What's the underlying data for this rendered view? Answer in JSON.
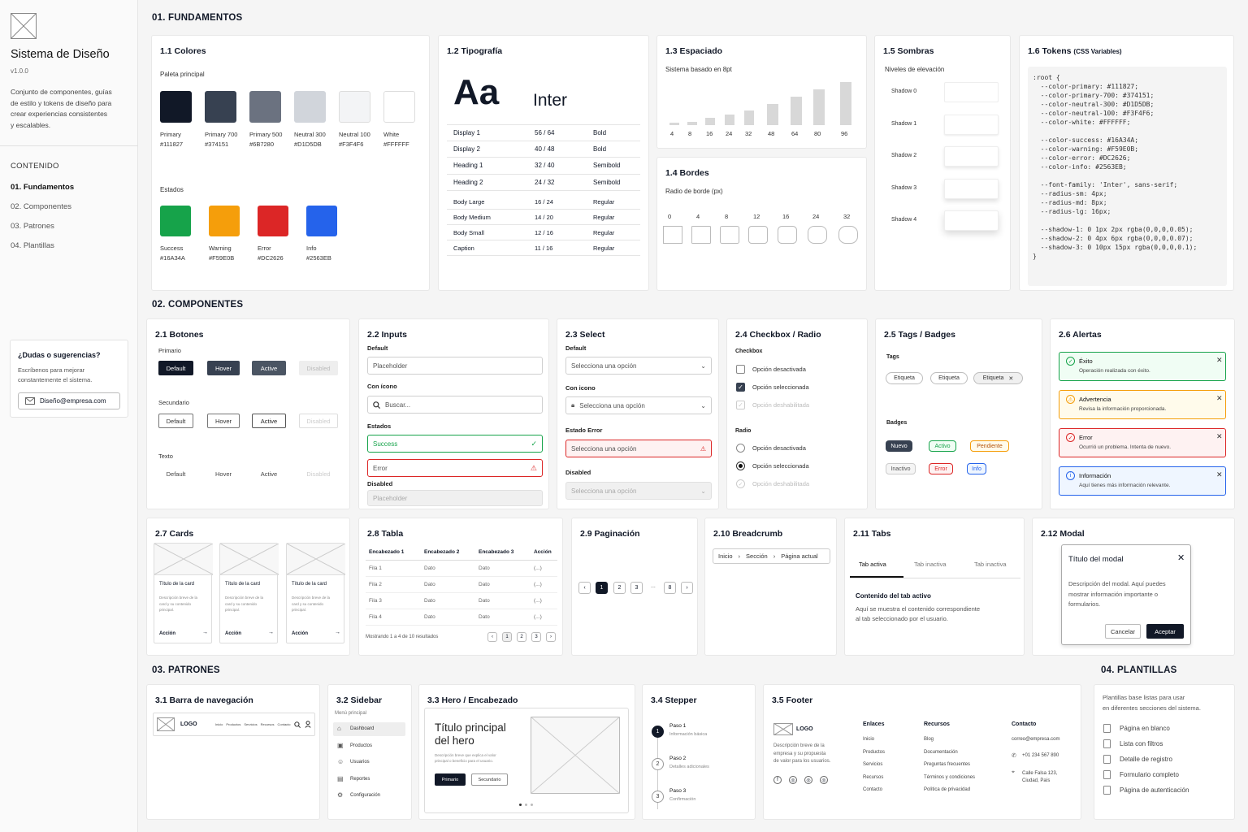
{
  "sidebar": {
    "title": "Sistema de Diseño",
    "version": "v1.0.0",
    "desc": [
      "Conjunto de componentes, guías",
      "de estilo y tokens de diseño para",
      "crear experiencias consistentes",
      "y escalables."
    ],
    "contents_label": "CONTENIDO",
    "nav": [
      "01. Fundamentos",
      "02. Componentes",
      "03. Patrones",
      "04. Plantillas"
    ],
    "help": {
      "title": "¿Dudas o sugerencias?",
      "text": [
        "Escríbenos para mejorar",
        "constantemente el sistema."
      ],
      "email": "Diseño@empresa.com"
    }
  },
  "sections": {
    "s1": "01. FUNDAMENTOS",
    "s2": "02. COMPONENTES",
    "s3": "03. PATRONES",
    "s4": "04. PLANTILLAS"
  },
  "colors": {
    "title": "1.1 Colores",
    "palette_label": "Paleta principal",
    "states_label": "Estados",
    "palette": [
      {
        "name": "Primary",
        "hex": "#111827"
      },
      {
        "name": "Primary 700",
        "hex": "#374151"
      },
      {
        "name": "Primary 500",
        "hex": "#6B7280"
      },
      {
        "name": "Neutral 300",
        "hex": "#D1D5DB"
      },
      {
        "name": "Neutral 100",
        "hex": "#F3F4F6"
      },
      {
        "name": "White",
        "hex": "#FFFFFF"
      }
    ],
    "states": [
      {
        "name": "Success",
        "hex": "#16A34A"
      },
      {
        "name": "Warning",
        "hex": "#F59E0B"
      },
      {
        "name": "Error",
        "hex": "#DC2626"
      },
      {
        "name": "Info",
        "hex": "#2563EB"
      }
    ]
  },
  "typo": {
    "title": "1.2 Tipografía",
    "sample": "Aa",
    "font": "Inter",
    "rows": [
      {
        "n": "Display 1",
        "s": "56 / 64",
        "w": "Bold"
      },
      {
        "n": "Display 2",
        "s": "40 / 48",
        "w": "Bold"
      },
      {
        "n": "Heading 1",
        "s": "32 / 40",
        "w": "Semibold"
      },
      {
        "n": "Heading 2",
        "s": "24 / 32",
        "w": "Semibold"
      },
      {
        "n": "Body Large",
        "s": "16 / 24",
        "w": "Regular"
      },
      {
        "n": "Body Medium",
        "s": "14 / 20",
        "w": "Regular"
      },
      {
        "n": "Body Small",
        "s": "12 / 16",
        "w": "Regular"
      },
      {
        "n": "Caption",
        "s": "11 / 16",
        "w": "Regular"
      }
    ]
  },
  "spacing": {
    "title": "1.3 Espaciado",
    "subtitle": "Sistema basado en 8pt",
    "values": [
      "4",
      "8",
      "16",
      "24",
      "32",
      "48",
      "64",
      "80",
      "96"
    ]
  },
  "borders": {
    "title": "1.4 Bordes",
    "subtitle": "Radio de borde (px)",
    "values": [
      "0",
      "4",
      "8",
      "12",
      "16",
      "24",
      "32"
    ]
  },
  "shadows": {
    "title": "1.5 Sombras",
    "subtitle": "Niveles de elevación",
    "items": [
      "Shadow 0",
      "Shadow 1",
      "Shadow 2",
      "Shadow 3",
      "Shadow 4"
    ]
  },
  "tokens": {
    "title": "1.6 Tokens",
    "title_suffix": "(CSS Variables)",
    "code": ":root {\n  --color-primary: #111827;\n  --color-primary-700: #374151;\n  --color-neutral-300: #D1D5DB;\n  --color-neutral-100: #F3F4F6;\n  --color-white: #FFFFFF;\n\n  --color-success: #16A34A;\n  --color-warning: #F59E0B;\n  --color-error: #DC2626;\n  --color-info: #2563EB;\n\n  --font-family: 'Inter', sans-serif;\n  --radius-sm: 4px;\n  --radius-md: 8px;\n  --radius-lg: 16px;\n\n  --shadow-1: 0 1px 2px rgba(0,0,0,0.05);\n  --shadow-2: 0 4px 6px rgba(0,0,0,0.07);\n  --shadow-3: 0 10px 15px rgba(0,0,0,0.1);\n}"
  },
  "buttons": {
    "title": "2.1 Botones",
    "primary": "Primario",
    "secondary": "Secundario",
    "text": "Texto",
    "states": [
      "Default",
      "Hover",
      "Active",
      "Disabled"
    ]
  },
  "inputs": {
    "title": "2.2 Inputs",
    "default": "Default",
    "placeholder": "Placeholder",
    "with_icon": "Con ícono",
    "search": "Buscar...",
    "states": "Estados",
    "success": "Success",
    "error": "Error",
    "disabled": "Disabled"
  },
  "select": {
    "title": "2.3 Select",
    "default": "Default",
    "option": "Selecciona una opción",
    "with_icon": "Con icono",
    "error": "Estado Error",
    "disabled": "Disabled"
  },
  "checkbox": {
    "title": "2.4 Checkbox / Radio",
    "cb": "Checkbox",
    "radio": "Radio",
    "opts": [
      "Opción desactivada",
      "Opción seleccionada",
      "Opción deshabilitada"
    ]
  },
  "tags": {
    "title": "2.5 Tags / Badges",
    "tags_label": "Tags",
    "tag": "Etiqueta",
    "badges_label": "Badges",
    "badges": [
      "Nuevo",
      "Activo",
      "Pendiente",
      "Inactivo",
      "Error",
      "Info"
    ]
  },
  "alerts": {
    "title": "2.6 Alertas",
    "items": [
      {
        "t": "Éxito",
        "d": "Operación realizada con éxito."
      },
      {
        "t": "Advertencia",
        "d": "Revisa la información proporcionada."
      },
      {
        "t": "Error",
        "d": "Ocurrió un problema. Intenta de nuevo."
      },
      {
        "t": "Información",
        "d": "Aquí tienes más información relevante."
      }
    ]
  },
  "cards": {
    "title": "2.7 Cards",
    "card_title": "Título de la card",
    "card_desc": [
      "Descripción breve de la",
      "card y su contenido",
      "principal."
    ],
    "action": "Acción"
  },
  "table": {
    "title": "2.8 Tabla",
    "headers": [
      "Encabezado 1",
      "Encabezado 2",
      "Encabezado 3",
      "Acción"
    ],
    "rows": [
      [
        "Fila 1",
        "Dato",
        "Dato",
        "(...)"
      ],
      [
        "Fila 2",
        "Dato",
        "Dato",
        "(...)"
      ],
      [
        "Fila 3",
        "Dato",
        "Dato",
        "(...)"
      ],
      [
        "Fila 4",
        "Dato",
        "Dato",
        "(...)"
      ]
    ],
    "footer": "Mostrando 1 a 4 de 10 resultados",
    "pages": [
      "1",
      "2",
      "3"
    ]
  },
  "pagination": {
    "title": "2.9 Paginación",
    "pages": [
      "1",
      "2",
      "3",
      "...",
      "8"
    ]
  },
  "breadcrumb": {
    "title": "2.10 Breadcrumb",
    "items": [
      "Inicio",
      "Sección",
      "Página actual"
    ]
  },
  "tabs": {
    "title": "2.11 Tabs",
    "tabs": [
      "Tab activa",
      "Tab inactiva",
      "Tab inactiva"
    ],
    "content_title": "Contenido del tab activo",
    "content": [
      "Aquí se muestra el contenido correspondiente",
      "al tab seleccionado por el usuario."
    ]
  },
  "modal": {
    "title": "2.12 Modal",
    "mtitle": "Título del modal",
    "desc": [
      "Descripción del modal. Aquí puedes",
      "mostrar información importante o",
      "formularios."
    ],
    "cancel": "Cancelar",
    "accept": "Aceptar"
  },
  "navbar": {
    "title": "3.1 Barra de navegación",
    "logo": "LOGO",
    "links": [
      "Inicio",
      "Productos",
      "Servicios",
      "Recursos",
      "Contacto"
    ]
  },
  "psidebar": {
    "title": "3.2 Sidebar",
    "menu": "Menú principal",
    "items": [
      "Dashboard",
      "Productos",
      "Usuarios",
      "Reportes",
      "Configuración"
    ]
  },
  "hero": {
    "title": "3.3 Hero / Encabezado",
    "h1": "Título principal",
    "h2": "del hero",
    "desc": [
      "Descripción breve que explica el valor",
      "principal o beneficio para el usuario."
    ],
    "primary": "Primario",
    "secondary": "Secundario"
  },
  "stepper": {
    "title": "3.4 Stepper",
    "steps": [
      {
        "n": "1",
        "t": "Paso 1",
        "d": "Información básica"
      },
      {
        "n": "2",
        "t": "Paso 2",
        "d": "Detalles adicionales"
      },
      {
        "n": "3",
        "t": "Paso 3",
        "d": "Confirmación"
      }
    ]
  },
  "footer": {
    "title": "3.5 Footer",
    "logo": "LOGO",
    "desc": [
      "Descripción breve de la",
      "empresa y su propuesta",
      "de valor para los usuarios."
    ],
    "c1": {
      "h": "Enlaces",
      "items": [
        "Inicio",
        "Productos",
        "Servicios",
        "Recursos",
        "Contacto"
      ]
    },
    "c2": {
      "h": "Recursos",
      "items": [
        "Blog",
        "Documentación",
        "Preguntas frecuentes",
        "Términos y condiciones",
        "Política de privacidad"
      ]
    },
    "c3": {
      "h": "Contacto",
      "email": "correo@empresa.com",
      "phone": "+01 234 567 890",
      "addr": [
        "Calle Falsa 123,",
        "Ciudad, País"
      ]
    }
  },
  "templates": {
    "desc": [
      "Plantillas base listas para usar",
      "en diferentes secciones del sistema."
    ],
    "items": [
      "Página en blanco",
      "Lista con filtros",
      "Detalle de registro",
      "Formulario completo",
      "Página de autenticación"
    ]
  }
}
